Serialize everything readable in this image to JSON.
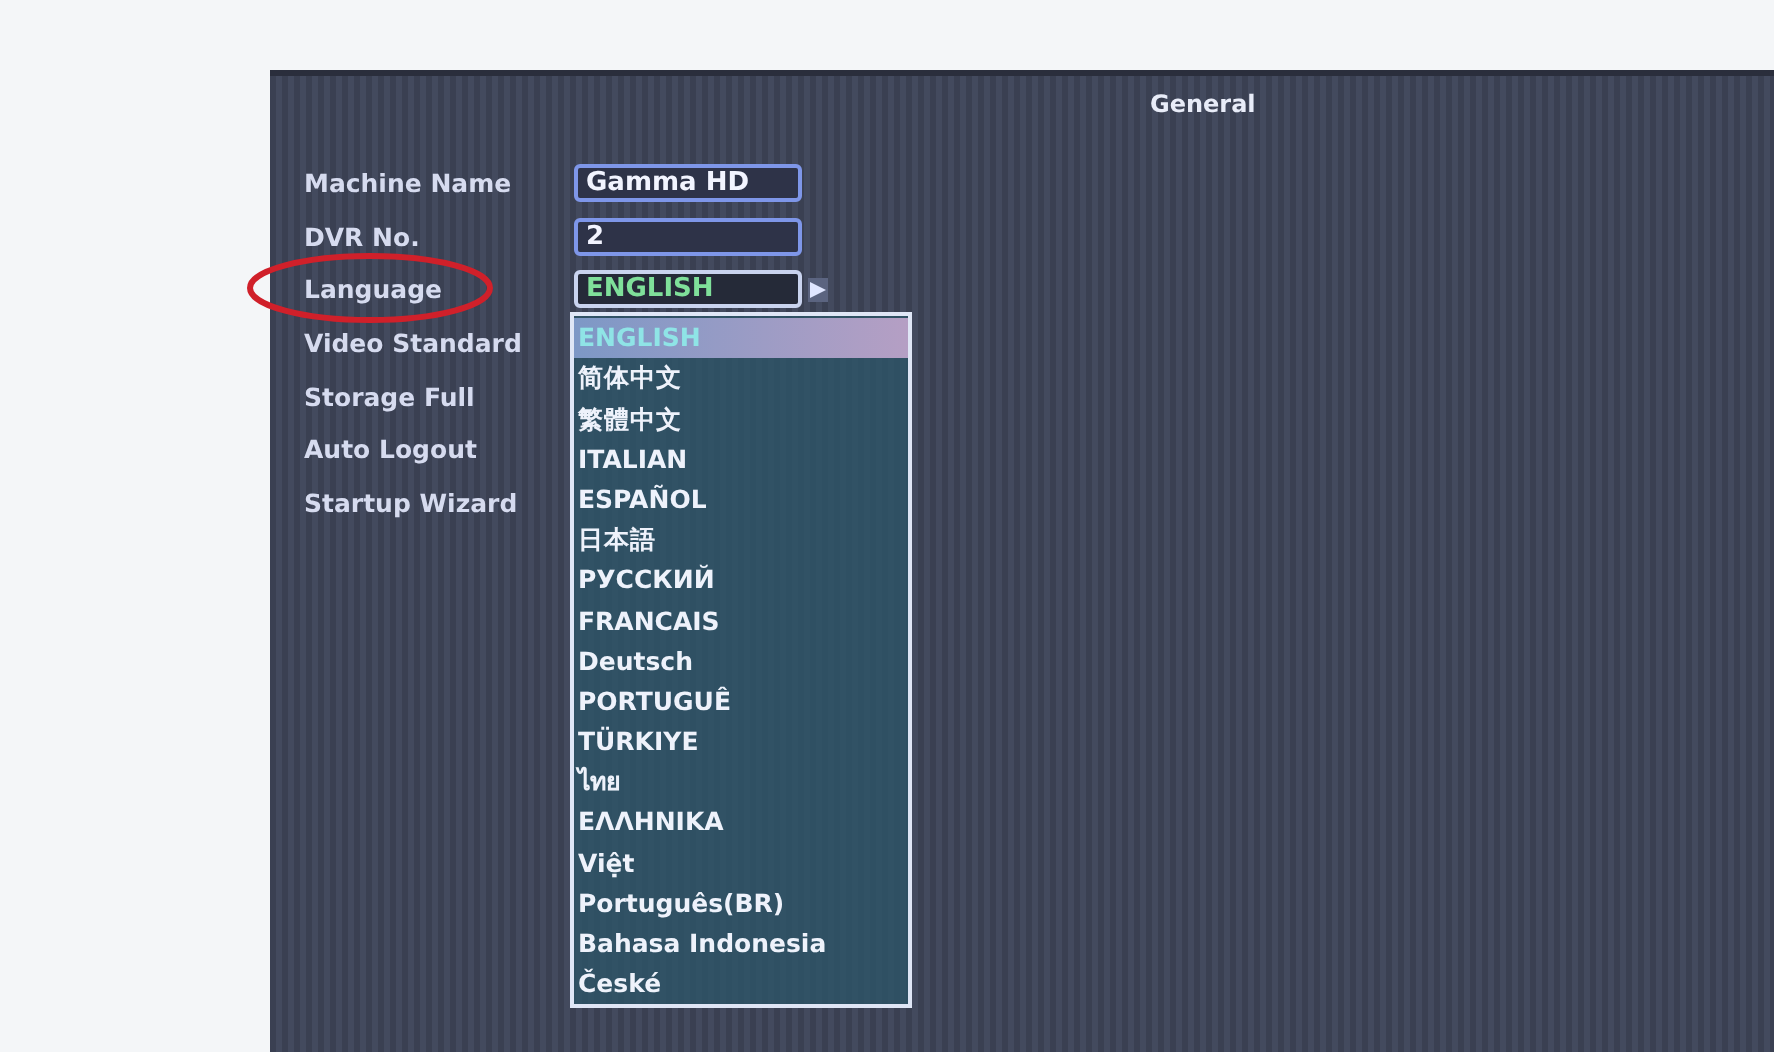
{
  "title": "General",
  "fields": [
    {
      "label": "Machine Name",
      "kind": "text",
      "value": "Gamma HD"
    },
    {
      "label": "DVR No.",
      "kind": "text",
      "value": "2"
    },
    {
      "label": "Language",
      "kind": "select",
      "value": "ENGLISH",
      "expanded": true,
      "highlighted": true
    },
    {
      "label": "Video Standard",
      "kind": "label"
    },
    {
      "label": "Storage Full",
      "kind": "label"
    },
    {
      "label": "Auto Logout",
      "kind": "label"
    },
    {
      "label": "Startup Wizard",
      "kind": "label"
    }
  ],
  "language_options": [
    {
      "label": "ENGLISH",
      "selected": true
    },
    {
      "label": "简体中文",
      "selected": false
    },
    {
      "label": "繁體中文",
      "selected": false
    },
    {
      "label": "ITALIAN",
      "selected": false
    },
    {
      "label": "ESPAÑOL",
      "selected": false
    },
    {
      "label": "日本語",
      "selected": false
    },
    {
      "label": "РУССКИЙ",
      "selected": false
    },
    {
      "label": "FRANCAIS",
      "selected": false
    },
    {
      "label": "Deutsch",
      "selected": false
    },
    {
      "label": "PORTUGUÊ",
      "selected": false
    },
    {
      "label": "TÜRKIYE",
      "selected": false
    },
    {
      "label": "ไทย",
      "selected": false
    },
    {
      "label": "ΕΛΛΗΝΙΚΑ",
      "selected": false
    },
    {
      "label": "Việt",
      "selected": false
    },
    {
      "label": "Português(BR)",
      "selected": false
    },
    {
      "label": "Bahasa Indonesia",
      "selected": false
    },
    {
      "label": "České",
      "selected": false
    }
  ]
}
